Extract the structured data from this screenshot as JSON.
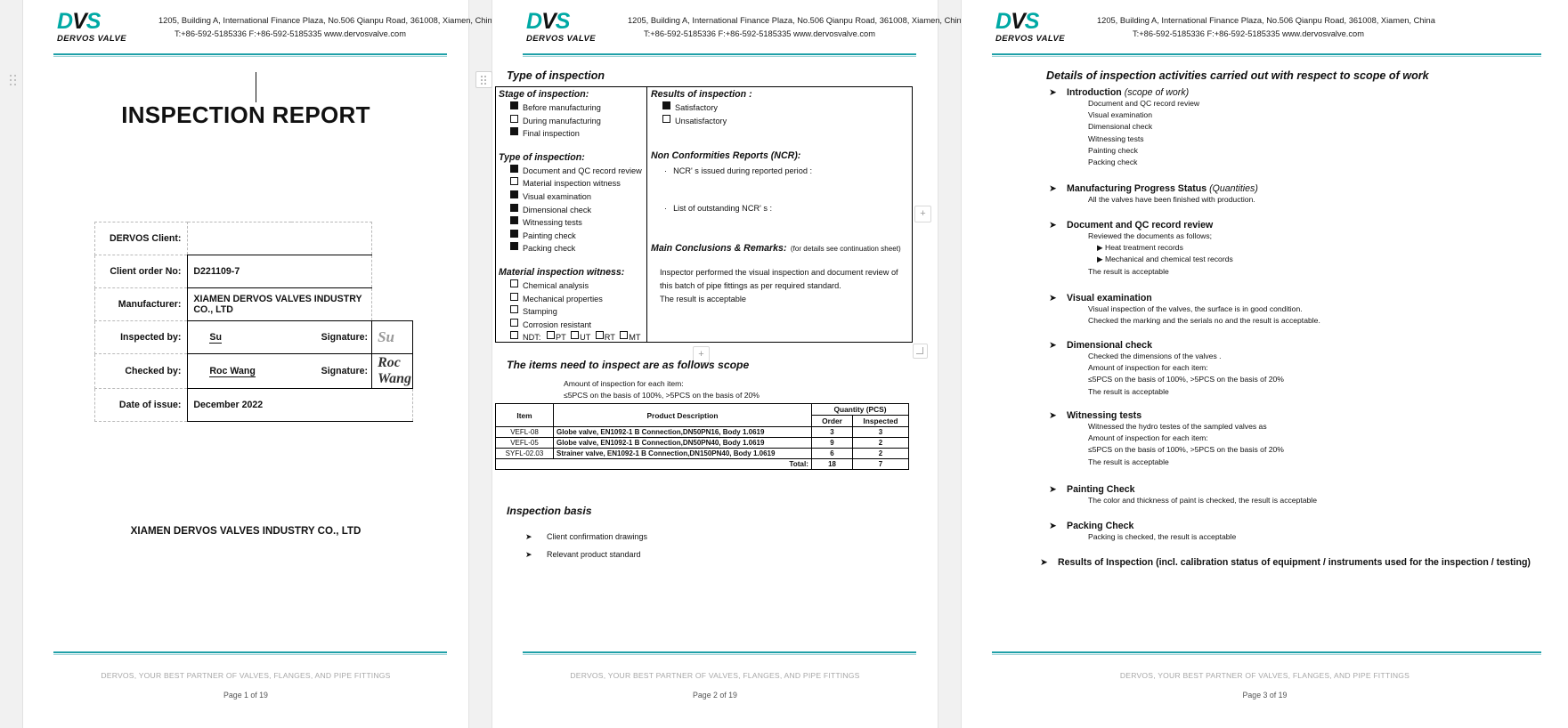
{
  "company": {
    "logo_main": "DVS",
    "logo_name": "DERVOS VALVE",
    "address_line1": "1205, Building A, International Finance Plaza, No.506 Qianpu Road, 361008, Xiamen, China",
    "address_line2": "T:+86-592-5185336   F:+86-592-5185335   www.dervosvalve.com",
    "accent_color": "#1fa0a8",
    "logo_color": "#00a9a5"
  },
  "footer": {
    "tagline": "DERVOS, YOUR BEST PARTNER OF VALVES, FLANGES, AND PIPE FITTINGS",
    "page1": "Page 1 of 19",
    "page2": "Page 2 of 19",
    "page3": "Page 3 of 19"
  },
  "page1": {
    "title": "INSPECTION REPORT",
    "company_footer": "XIAMEN DERVOS VALVES INDUSTRY CO., LTD",
    "fields": [
      {
        "label": "DERVOS Client:",
        "value": ""
      },
      {
        "label": "Client order No:",
        "value": "D221109-7"
      },
      {
        "label": "Manufacturer:",
        "value": "XIAMEN DERVOS VALVES INDUSTRY CO., LTD"
      }
    ],
    "inspected_by": {
      "label": "Inspected by:",
      "name": "Su",
      "sig_label": "Signature:",
      "signature": "Su"
    },
    "checked_by": {
      "label": "Checked by:",
      "name": "Roc Wang",
      "sig_label": "Signature:",
      "signature": "Roc Wang"
    },
    "date_of_issue": {
      "label": "Date of issue:",
      "value": "December 2022"
    }
  },
  "page2": {
    "heading": "Type of inspection",
    "stage": {
      "title": "Stage of inspection:",
      "items": [
        {
          "label": "Before manufacturing",
          "checked": true
        },
        {
          "label": "During manufacturing",
          "checked": false
        },
        {
          "label": "Final inspection",
          "checked": true
        }
      ]
    },
    "type": {
      "title": "Type of inspection:",
      "items": [
        {
          "label": "Document and QC record review",
          "checked": true
        },
        {
          "label": "Material inspection witness",
          "checked": false
        },
        {
          "label": "Visual examination",
          "checked": true
        },
        {
          "label": "Dimensional check",
          "checked": true
        },
        {
          "label": "Witnessing tests",
          "checked": true
        },
        {
          "label": "Painting check",
          "checked": true
        },
        {
          "label": "Packing check",
          "checked": true
        }
      ]
    },
    "material": {
      "title": "Material inspection witness:",
      "items": [
        {
          "label": "Chemical analysis",
          "checked": false
        },
        {
          "label": "Mechanical properties",
          "checked": false
        },
        {
          "label": "Stamping",
          "checked": false
        },
        {
          "label": "Corrosion resistant",
          "checked": false
        }
      ],
      "ndt_label": "NDT:",
      "ndt_options": [
        "PT",
        "UT",
        "RT",
        "MT"
      ]
    },
    "results": {
      "title": "Results of inspection :",
      "items": [
        {
          "label": "Satisfactory",
          "checked": true
        },
        {
          "label": "Unsatisfactory",
          "checked": false
        }
      ]
    },
    "ncr": {
      "title": "Non Conformities Reports (NCR):",
      "line1": "NCR' s issued during reported period :",
      "line2": "List of outstanding NCR' s :"
    },
    "conclusions": {
      "title": "Main Conclusions & Remarks:",
      "title_note": "(for details see continuation sheet)",
      "body_line1": "Inspector performed the visual inspection and document review of",
      "body_line2": "this batch of pipe fittings as per required standard.",
      "body_line3": "The result is acceptable"
    },
    "scope": {
      "heading": "The items need to inspect are as follows scope",
      "note1": "Amount of inspection for each item:",
      "note2": "≤5PCS on the basis of 100%,    >5PCS on the basis of 20%"
    },
    "table": {
      "headers": {
        "item": "Item",
        "product": "Product Description",
        "quantity": "Quantity (PCS)",
        "order": "Order",
        "inspected": "Inspected"
      },
      "rows": [
        {
          "item": "VEFL-08",
          "product": "Globe valve, EN1092-1 B Connection,DN50PN16, Body 1.0619",
          "order": "3",
          "inspected": "3"
        },
        {
          "item": "VEFL-05",
          "product": "Globe valve, EN1092-1 B Connection,DN50PN40, Body 1.0619",
          "order": "9",
          "inspected": "2"
        },
        {
          "item": "SYFL-02.03",
          "product": "Strainer valve, EN1092-1 B Connection,DN150PN40, Body 1.0619",
          "order": "6",
          "inspected": "2"
        }
      ],
      "total_label": "Total:",
      "total_order": "18",
      "total_inspected": "7"
    },
    "basis": {
      "heading": "Inspection basis",
      "items": [
        "Client confirmation drawings",
        "Relevant product standard"
      ]
    }
  },
  "page3": {
    "heading": "Details of inspection activities carried out with respect to scope of work",
    "sections": [
      {
        "title": "Introduction",
        "title_note": "(scope of work)",
        "lines": [
          "Document and QC record review",
          "Visual examination",
          "Dimensional check",
          "Witnessing tests",
          "Painting check",
          "Packing check"
        ]
      },
      {
        "title": "Manufacturing Progress Status",
        "title_note": "(Quantities)",
        "lines": [
          "All the valves have been finished with production."
        ]
      },
      {
        "title": "Document and QC record review",
        "title_note": "",
        "lines": [
          "Reviewed the documents as follows;",
          "▶ Heat treatment records",
          "▶ Mechanical and chemical test records",
          "The result is acceptable"
        ]
      },
      {
        "title": "Visual examination",
        "title_note": "",
        "lines": [
          "Visual inspection of the valves, the surface is in good condition.",
          "Checked the marking and the serials no and the result is acceptable."
        ]
      },
      {
        "title": "Dimensional check",
        "title_note": "",
        "lines": [
          "Checked the dimensions of the valves .",
          "Amount of inspection for each item:",
          "≤5PCS on the basis of 100%,    >5PCS on the basis of 20%",
          "The result is acceptable"
        ]
      },
      {
        "title": "Witnessing tests",
        "title_note": "",
        "lines": [
          "Witnessed the hydro testes of the sampled valves as",
          "Amount of inspection for each item:",
          "≤5PCS on the basis of 100%,    >5PCS on the basis of 20%",
          "The result is acceptable"
        ]
      },
      {
        "title": "Painting Check",
        "title_note": "",
        "lines": [
          "The color and thickness of paint is checked, the result is acceptable"
        ]
      },
      {
        "title": "Packing Check",
        "title_note": "",
        "lines": [
          "Packing is checked, the result is acceptable"
        ]
      }
    ],
    "last_heading_line1": "Results of Inspection (incl. calibration status of equipment / instruments used",
    "last_heading_line2": "for the inspection / testing)"
  }
}
